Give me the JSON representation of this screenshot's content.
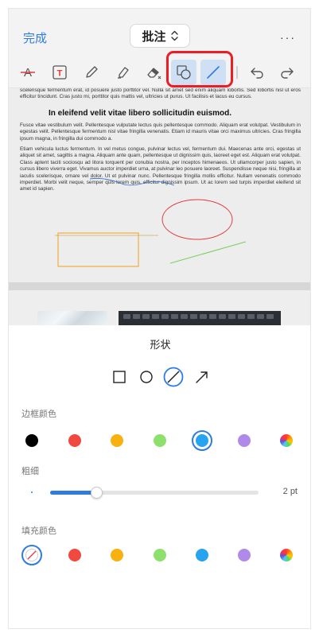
{
  "header": {
    "done_label": "完成",
    "mode_label": "批注",
    "more_label": "···"
  },
  "toolbar": {
    "tools": [
      {
        "name": "strikethrough-text-icon",
        "active": false
      },
      {
        "name": "text-box-icon",
        "active": false
      },
      {
        "name": "pencil-icon",
        "active": false
      },
      {
        "name": "highlighter-icon",
        "active": false
      },
      {
        "name": "eraser-icon",
        "active": false
      },
      {
        "name": "shapes-icon",
        "active": true
      },
      {
        "name": "line-icon",
        "active": true
      },
      {
        "name": "undo-icon",
        "active": false
      },
      {
        "name": "redo-icon",
        "active": false
      }
    ],
    "strike_glyph": "A",
    "textbox_glyph": "T"
  },
  "document": {
    "para1": "scelerisque fermentum erat, id posuere justo porttitor vel. Nulla sit amet sed enim aliquam lobortis. Sed lobortis nisl ut eros efficitur tincidunt. Cras justo mi, porttitor quis mattis vel, ultricies ut purus. Ut facilisis et lacus eu cursus.",
    "heading": "In eleifend velit vitae libero sollicitudin euismod.",
    "para2": "Fusce vitae vestibulum velit. Pellentesque vulputate lectus quis pellentesque commodo. Aliquam erat volutpat. Vestibulum in egestas velit. Pellentesque fermentum nisl vitae fringilla venenatis. Etiam id mauris vitae orci maximus ultricies. Cras fringilla ipsum magna, in fringilla dui commodo a.",
    "para3": "Etiam vehicula luctus fermentum. In vel metus congue, pulvinar lectus vel, fermentum dui. Maecenas ante orci, egestas ut aliquet sit amet, sagittis a magna. Aliquam ante quam, pellentesque ut dignissim quis, laoreet eget est. Aliquam erat volutpat. Class aptent taciti sociosqu ad litora torquent per conubia nostra, per inceptos himenaeos. Ut ullamcorper justo sapien, in cursus libero viverra eget. Vivamus auctor imperdiet urna, at pulvinar leo posuere laoreet. Suspendisse neque nisi, fringilla at iaculis scelerisque, ornare vel dolor. Ut et pulvinar nunc. Pellentesque fringilla mollis efficitur. Nullam venenatis commodo imperdiet. Morbi velit neque, semper quis lorem quis, efficitur dignissim ipsum. Ut ac lorem sed turpis imperdiet eleifend sit amet id sapien."
  },
  "panel": {
    "title": "形状",
    "shapes": [
      {
        "name": "rectangle-shape-icon",
        "selected": false
      },
      {
        "name": "circle-shape-icon",
        "selected": false
      },
      {
        "name": "line-shape-icon",
        "selected": true
      },
      {
        "name": "arrow-shape-icon",
        "selected": false
      }
    ],
    "border_color_label": "边框颜色",
    "border_colors": [
      "#000000",
      "#f04a40",
      "#f8b10e",
      "#8de06c",
      "#27a3f0",
      "#b08ae8",
      "rainbow"
    ],
    "border_selected": "#27a3f0",
    "thickness_label": "粗细",
    "thickness_fraction": 0.22,
    "thickness_value": "2 pt",
    "fill_color_label": "填充颜色",
    "fill_colors": [
      "none",
      "#f04a40",
      "#f8b10e",
      "#8de06c",
      "#27a3f0",
      "#b08ae8",
      "rainbow"
    ],
    "fill_selected": "none"
  },
  "colors": {
    "accent": "#2f7be0",
    "highlight_red": "#ee1c25"
  }
}
